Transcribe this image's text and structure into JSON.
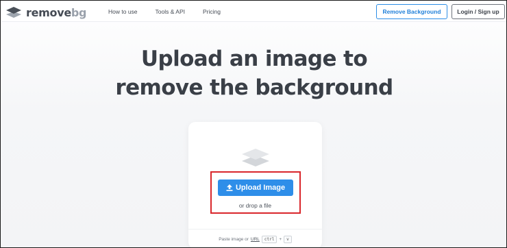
{
  "header": {
    "logo_main": "remove",
    "logo_suffix": "bg",
    "nav": [
      "How to use",
      "Tools & API",
      "Pricing"
    ],
    "remove_background_button": "Remove Background",
    "login_button": "Login / Sign up"
  },
  "hero": {
    "title_line1": "Upload an image to",
    "title_line2": "remove the background"
  },
  "upload": {
    "button_label": "Upload Image",
    "drop_text": "or drop a file",
    "paste_prefix": "Paste image or",
    "paste_url": "URL",
    "shortcut_key1": "ctrl",
    "shortcut_plus": "+",
    "shortcut_key2": "v"
  },
  "colors": {
    "accent_blue": "#2e8ee9",
    "highlight_red": "#d9262b",
    "text_dark": "#3a3f47"
  },
  "icons": {
    "logo": "layers-icon",
    "card": "layers-icon",
    "upload": "upload-arrow-icon"
  }
}
